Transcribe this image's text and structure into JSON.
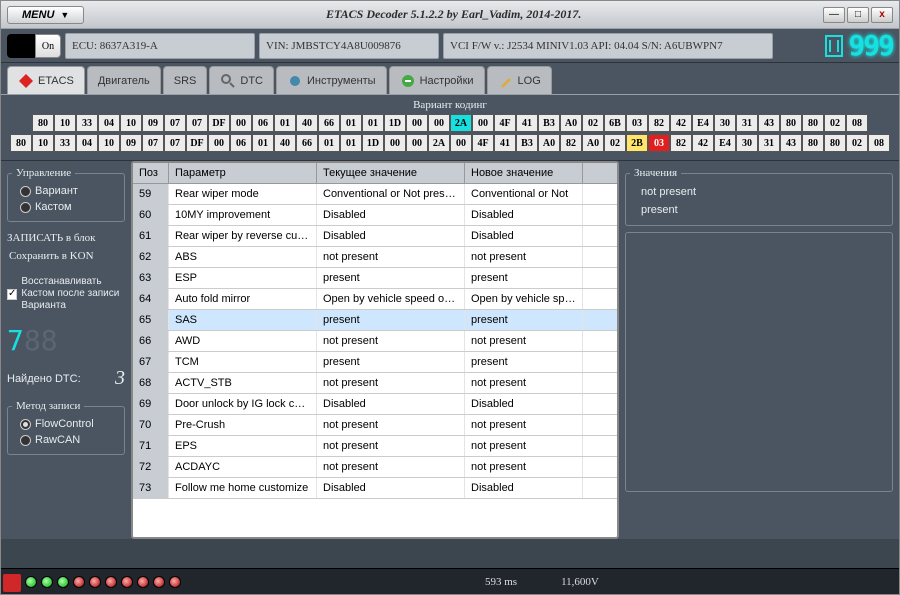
{
  "title": "ETACS Decoder 5.1.2.2 by Earl_Vadim, 2014-2017.",
  "menu": {
    "label": "MENU"
  },
  "winctl": {
    "min": "—",
    "max": "□",
    "close": "x"
  },
  "on_btn": "On",
  "info": {
    "ecu": "ECU: 8637A319-A",
    "vin": "VIN: JMBSTCY4A8U009876",
    "vci": "VCI F/W v.: J2534 MINIV1.03 API: 04.04 S/N: A6UBWPN7"
  },
  "logo_digits": "999",
  "tabs": [
    {
      "label": "ETACS",
      "active": true,
      "icon": "diamond-red"
    },
    {
      "label": "Двигатель",
      "active": false
    },
    {
      "label": "SRS",
      "active": false
    },
    {
      "label": "DTC",
      "active": false,
      "icon": "search"
    },
    {
      "label": "Инструменты",
      "active": false,
      "icon": "gear"
    },
    {
      "label": "Настройки",
      "active": false,
      "icon": "wrench"
    },
    {
      "label": "LOG",
      "active": false,
      "icon": "pencil"
    }
  ],
  "hex": {
    "label": "Вариант кодинг",
    "row1": [
      "80",
      "10",
      "33",
      "04",
      "10",
      "09",
      "07",
      "07",
      "DF",
      "00",
      "06",
      "01",
      "40",
      "66",
      "01",
      "01",
      "1D",
      "00",
      "00",
      "2A",
      "00",
      "4F",
      "41",
      "B3",
      "A0",
      "02",
      "6B",
      "03",
      "82",
      "42",
      "E4",
      "30",
      "31",
      "43",
      "80",
      "80",
      "02",
      "08"
    ],
    "row2": [
      "80",
      "10",
      "33",
      "04",
      "10",
      "09",
      "07",
      "07",
      "DF",
      "00",
      "06",
      "01",
      "40",
      "66",
      "01",
      "01",
      "1D",
      "00",
      "00",
      "2A",
      "00",
      "4F",
      "41",
      "B3",
      "A0",
      "82",
      "A0",
      "02",
      "2B",
      "03",
      "82",
      "42",
      "E4",
      "30",
      "31",
      "43",
      "80",
      "80",
      "02",
      "08"
    ],
    "hi1": {
      "19": "cyan"
    },
    "hi2": {
      "28": "yel",
      "29": "red"
    }
  },
  "side": {
    "grp1": "Управление",
    "opt_variant": "Вариант",
    "opt_custom": "Кастом",
    "grp2": "ЗАПИСАТЬ в блок",
    "select_label": "Сохранить в KON",
    "chk_restore": "Восстанавливать Кастом после записи Варианта",
    "seg": "7",
    "dtc_label": "Найдено DTC:",
    "dtc_count": "3",
    "grp3": "Метод записи",
    "opt_flow": "FlowControl",
    "opt_raw": "RawCAN"
  },
  "grid": {
    "hdr": {
      "pos": "Поз",
      "par": "Параметр",
      "cur": "Текущее значение",
      "new": "Новое значение"
    },
    "rows": [
      {
        "pos": "59",
        "par": "Rear wiper mode",
        "cur": "Conventional or Not present",
        "new": "Conventional or Not"
      },
      {
        "pos": "60",
        "par": "10MY improvement",
        "cur": "Disabled",
        "new": "Disabled"
      },
      {
        "pos": "61",
        "par": "Rear wiper by reverse custom",
        "cur": "Disabled",
        "new": "Disabled"
      },
      {
        "pos": "62",
        "par": "ABS",
        "cur": "not present",
        "new": "not present"
      },
      {
        "pos": "63",
        "par": "ESP",
        "cur": "present",
        "new": "present"
      },
      {
        "pos": "64",
        "par": "Auto fold mirror",
        "cur": "Open by vehicle speed or Not",
        "new": "Open by vehicle speed"
      },
      {
        "pos": "65",
        "par": "SAS",
        "cur": "present",
        "new": "present",
        "sel": true
      },
      {
        "pos": "66",
        "par": "AWD",
        "cur": "not present",
        "new": "not present"
      },
      {
        "pos": "67",
        "par": "TCM",
        "cur": "present",
        "new": "present"
      },
      {
        "pos": "68",
        "par": "ACTV_STB",
        "cur": "not present",
        "new": "not present"
      },
      {
        "pos": "69",
        "par": "Door unlock by IG lock customi",
        "cur": "Disabled",
        "new": "Disabled"
      },
      {
        "pos": "70",
        "par": "Pre-Crush",
        "cur": "not present",
        "new": "not present"
      },
      {
        "pos": "71",
        "par": "EPS",
        "cur": "not present",
        "new": "not present"
      },
      {
        "pos": "72",
        "par": "ACDAYC",
        "cur": "not present",
        "new": "not present"
      },
      {
        "pos": "73",
        "par": "Follow me home customize",
        "cur": "Disabled",
        "new": "Disabled"
      }
    ]
  },
  "rside": {
    "grp": "Значения",
    "opt_np": "not present",
    "opt_p": "present"
  },
  "status": {
    "ms": "593 ms",
    "volt": "11,600V",
    "leds": [
      "g",
      "g",
      "g",
      "r",
      "r",
      "r",
      "r",
      "r",
      "r",
      "r"
    ]
  }
}
